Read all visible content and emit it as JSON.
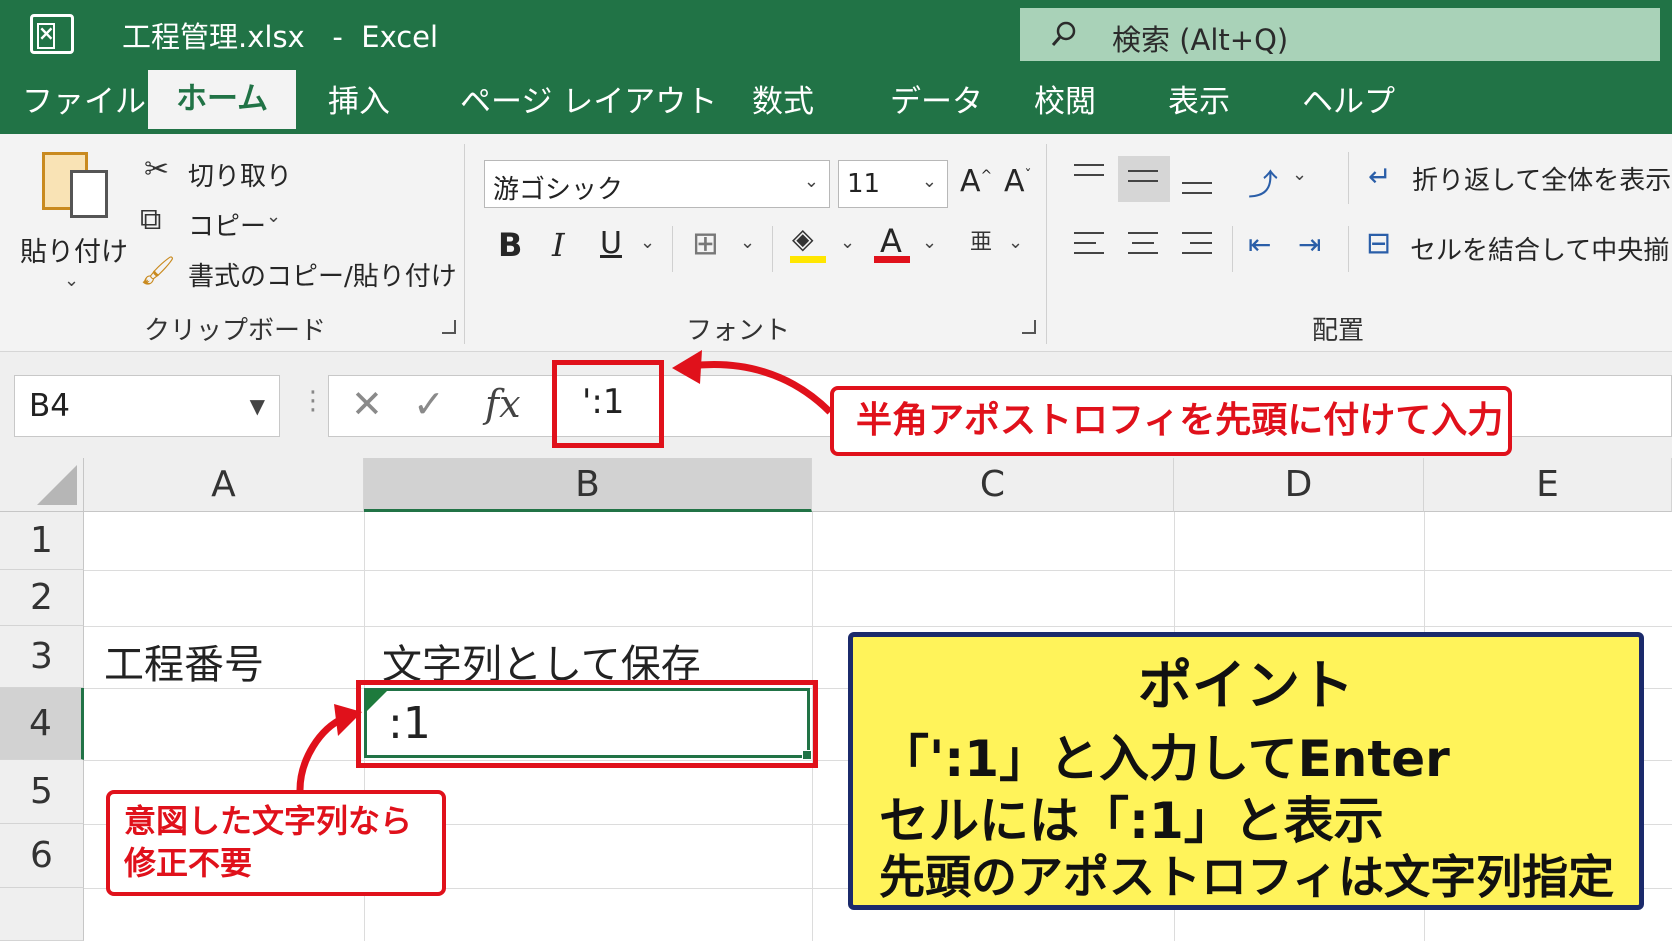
{
  "window": {
    "title": "工程管理.xlsx   -  Excel",
    "search_placeholder": "検索 (Alt+Q)"
  },
  "tabs": [
    {
      "label": "ファイル"
    },
    {
      "label": "ホーム",
      "active": true
    },
    {
      "label": "挿入"
    },
    {
      "label": "ページ レイアウト"
    },
    {
      "label": "数式"
    },
    {
      "label": "データ"
    },
    {
      "label": "校閲"
    },
    {
      "label": "表示"
    },
    {
      "label": "ヘルプ"
    }
  ],
  "ribbon": {
    "clipboard": {
      "paste": "貼り付け",
      "cut": "切り取り",
      "copy": "コピー",
      "format_painter": "書式のコピー/貼り付け",
      "group_label": "クリップボード"
    },
    "font": {
      "font_name": "游ゴシック",
      "font_size": "11",
      "bold": "B",
      "italic": "I",
      "underline": "U",
      "font_color_letter": "A",
      "grow_font": "A",
      "shrink_font": "A",
      "group_label": "フォント",
      "highlight_color": "#ffe600",
      "font_color": "#e0111b"
    },
    "alignment": {
      "wrap_text": "折り返して全体を表示",
      "merge_center": "セルを結合して中央揃え",
      "group_label": "配置"
    }
  },
  "formula_bar": {
    "name_box": "B4",
    "cancel": "✕",
    "enter": "✓",
    "fx": "fx",
    "value": "':1"
  },
  "sheet": {
    "columns": [
      "A",
      "B",
      "C",
      "D",
      "E"
    ],
    "rows": [
      "1",
      "2",
      "3",
      "4",
      "5",
      "6"
    ],
    "cells": {
      "A3": "工程番号",
      "B3": "文字列として保存",
      "B4": ":1"
    },
    "selected_cell": "B4"
  },
  "callouts": {
    "formula_note": "半角アポストロフィを先頭に付けて入力",
    "cell_note_line1": "意図した文字列なら",
    "cell_note_line2": "修正不要",
    "point_title": "ポイント",
    "point_line1": "「':1」と入力してEnter",
    "point_line2": "セルには「:1」と表示",
    "point_line3": "先頭のアポストロフィは文字列指定"
  },
  "colors": {
    "excel_green": "#217346",
    "callout_red": "#e0111b",
    "point_bg": "#fff35a",
    "point_border": "#1b2a6b"
  }
}
